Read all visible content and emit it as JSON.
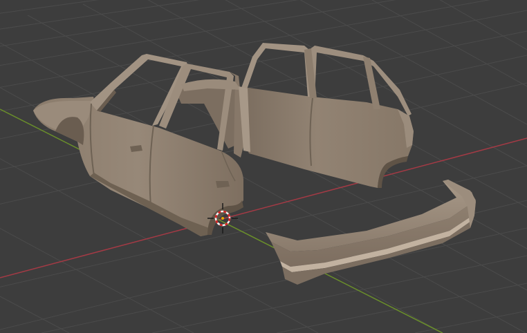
{
  "viewport": {
    "background": "#3d3d3d",
    "grid_color": "#4a4a4a",
    "x_axis_color": "#a43a45",
    "y_axis_color": "#6a8f2a"
  },
  "objects": {
    "material_base": "#8c7d6d",
    "material_light": "#a8998a",
    "material_dark": "#5e5246",
    "material_edge": "#b3a494"
  },
  "cursor_3d": {
    "ring_red": "#d82020",
    "ring_white": "#f2f2f2",
    "center_dot": "#e8a800"
  }
}
